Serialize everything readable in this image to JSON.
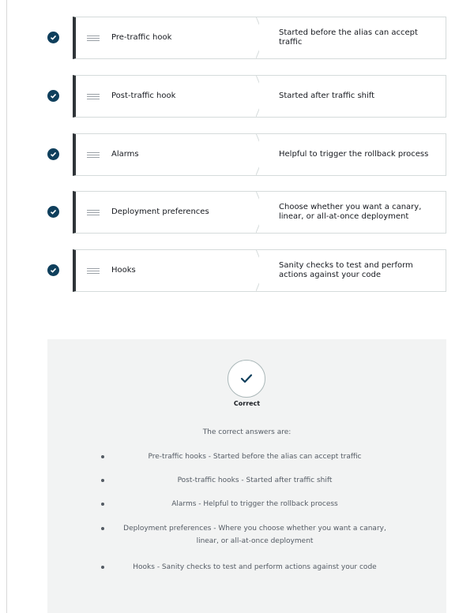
{
  "matches": [
    {
      "term": "Pre-traffic hook",
      "description": "Started before the alias can accept traffic",
      "status": "correct"
    },
    {
      "term": "Post-traffic hook",
      "description": "Started after traffic shift",
      "status": "correct"
    },
    {
      "term": "Alarms",
      "description": "Helpful to trigger the rollback process",
      "status": "correct"
    },
    {
      "term": "Deployment preferences",
      "description": "Choose whether you want a canary, linear, or all-at-once deployment",
      "status": "correct"
    },
    {
      "term": "Hooks",
      "description": "Sanity checks to test and perform actions against your code",
      "status": "correct"
    }
  ],
  "feedback": {
    "result": "Correct",
    "heading": "The correct answers are:",
    "answers": [
      "Pre-traffic hooks - Started before the alias can accept traffic",
      "Post-traffic hooks - Started after traffic shift",
      "Alarms - Helpful to trigger the rollback process",
      "Deployment preferences - Where you choose whether you want a canary, linear, or all-at-once deployment",
      "Hooks - Sanity checks to test and perform actions against your code"
    ]
  },
  "colors": {
    "check_badge": "#0f3f5c",
    "drag_accent": "#2f3438",
    "panel_bg": "#f2f3f3"
  },
  "icons": {
    "status": "checkmark-icon",
    "drag": "drag-handle-icon"
  }
}
